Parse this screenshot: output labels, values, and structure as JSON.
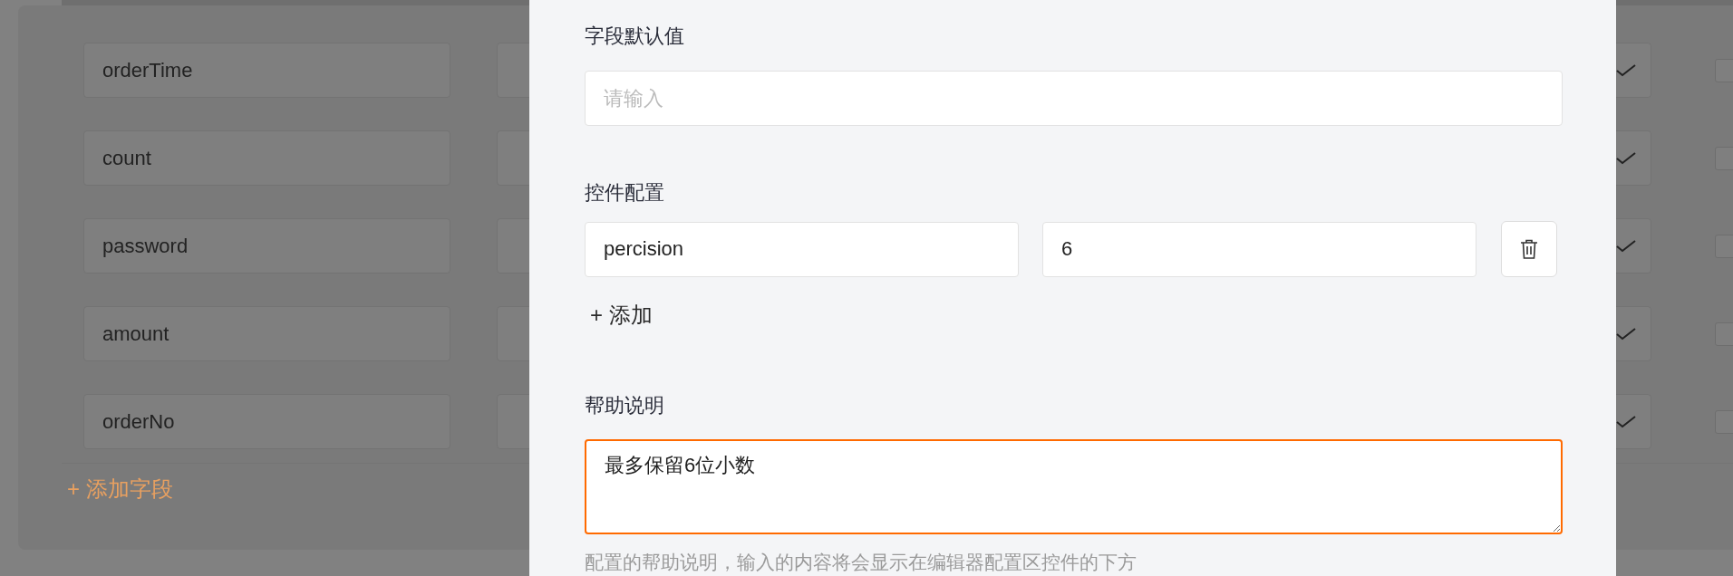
{
  "fields": [
    {
      "name": "orderTime",
      "checked": false
    },
    {
      "name": "count",
      "checked": false
    },
    {
      "name": "password",
      "checked": false
    },
    {
      "name": "amount",
      "checked": false
    },
    {
      "name": "orderNo",
      "checked": false
    }
  ],
  "add_field": "+ 添加字段",
  "dialog": {
    "default_value": {
      "label": "字段默认值",
      "placeholder": "请输入"
    },
    "control_config": {
      "label": "控件配置",
      "rows": [
        {
          "key": "percision",
          "value": "6"
        }
      ],
      "add": "+ 添加"
    },
    "help": {
      "label": "帮助说明",
      "value": "最多保留6位小数",
      "hint": "配置的帮助说明，输入的内容将会显示在编辑器配置区控件的下方"
    }
  }
}
